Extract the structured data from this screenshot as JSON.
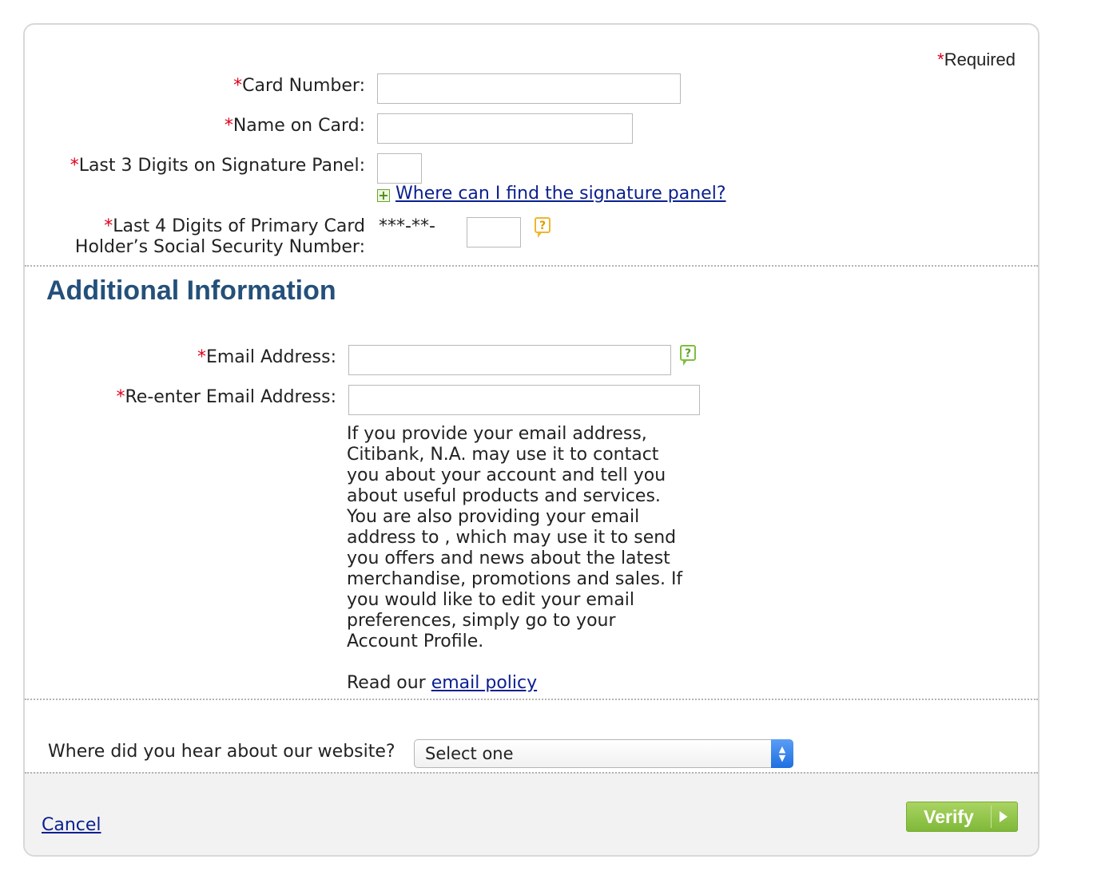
{
  "required_note": {
    "asterisk": "*",
    "text": "Required"
  },
  "card": {
    "card_number_label": "Card Number:",
    "name_on_card_label": "Name on Card:",
    "last3_label": "Last 3 Digits on Signature Panel:",
    "signature_help_link": "Where can I find the signature panel?",
    "ssn_label_line1": "Last 4 Digits of Primary Card",
    "ssn_label_line2": "Holder’s Social Security Number:",
    "ssn_mask": "***-**-"
  },
  "additional": {
    "title": "Additional Information",
    "email_label": "Email Address:",
    "reenter_email_label": "Re-enter Email Address:",
    "disclosure_lines": [
      "If you provide your email address,",
      "Citibank, N.A. may use it to contact",
      "you about your account and tell you",
      "about useful products and services.",
      "You are also providing your email",
      "address to , which may use it to send",
      "you offers and news about the latest",
      "merchandise, promotions and sales. If",
      "you would like to edit your email",
      "preferences, simply go to your",
      "Account Profile."
    ],
    "read_policy_prefix": "Read our ",
    "email_policy_link": "email policy"
  },
  "referral": {
    "question": "Where did you hear about our website?",
    "selected": "Select one"
  },
  "footer": {
    "cancel_label": "Cancel",
    "verify_label": "Verify"
  },
  "icons": {
    "help_yellow": "help-bubble-icon",
    "help_green": "help-bubble-icon",
    "expand": "plus-icon"
  },
  "colors": {
    "required_asterisk": "#e0001b",
    "section_title": "#24507a",
    "link": "#0a1f8f",
    "verify_button": "#8fc444"
  }
}
